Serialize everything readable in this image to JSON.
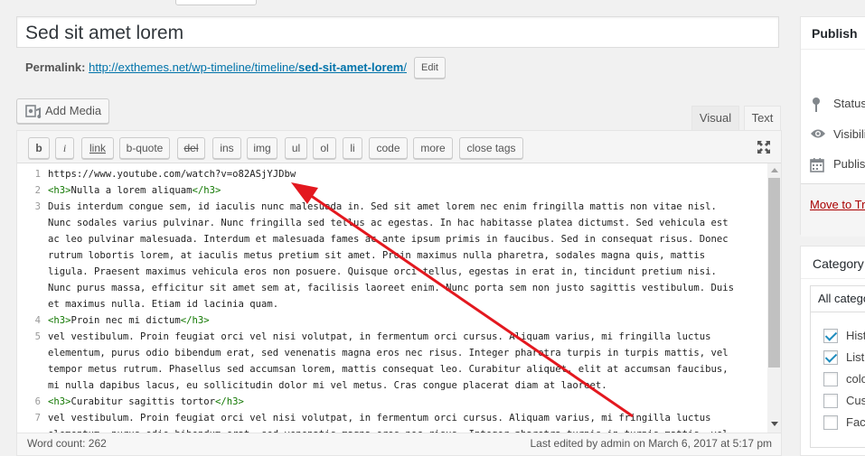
{
  "post": {
    "title": "Sed sit amet lorem",
    "permalink_label": "Permalink:",
    "permalink_base": "http://exthemes.net/wp-timeline/timeline/",
    "permalink_slug": "sed-sit-amet-lorem",
    "permalink_end": "/",
    "edit_label": "Edit"
  },
  "media": {
    "add_media_label": "Add Media"
  },
  "editor_tabs": {
    "visual": "Visual",
    "text": "Text"
  },
  "quicktags": [
    "b",
    "i",
    "link",
    "b-quote",
    "del",
    "ins",
    "img",
    "ul",
    "ol",
    "li",
    "code",
    "more",
    "close tags"
  ],
  "code_lines": [
    {
      "num": "1",
      "text": "https://www.youtube.com/watch?v=o82ASjYJDbw"
    },
    {
      "num": "2",
      "open": "<h3>",
      "text": "Nulla a lorem aliquam",
      "close": "</h3>"
    },
    {
      "num": "3",
      "text": "Duis interdum congue sem, id iaculis nunc malesuada in. Sed sit amet lorem nec enim fringilla mattis non vitae nisl."
    },
    {
      "num": "",
      "text": "Nunc sodales varius pulvinar. Nunc fringilla sed tellus ac egestas. In hac habitasse platea dictumst. Sed vehicula est"
    },
    {
      "num": "",
      "text": "ac leo pulvinar malesuada. Interdum et malesuada fames ac ante ipsum primis in faucibus. Sed in consequat risus. Donec"
    },
    {
      "num": "",
      "text": "rutrum lobortis lorem, at iaculis metus pretium sit amet. Proin maximus nulla pharetra, sodales magna quis, mattis"
    },
    {
      "num": "",
      "text": "ligula. Praesent maximus vehicula eros non posuere. Quisque orci tellus, egestas in erat in, tincidunt pretium nisi."
    },
    {
      "num": "",
      "text": "Nunc purus massa, efficitur sit amet sem at, facilisis laoreet enim. Nunc porta sem non justo sagittis vestibulum. Duis"
    },
    {
      "num": "",
      "text": "et maximus nulla. Etiam id lacinia quam."
    },
    {
      "num": "4",
      "open": "<h3>",
      "text": "Proin nec mi dictum",
      "close": "</h3>"
    },
    {
      "num": "5",
      "text": "vel vestibulum. Proin feugiat orci vel nisi volutpat, in fermentum orci cursus. Aliquam varius, mi fringilla luctus"
    },
    {
      "num": "",
      "text": "elementum, purus odio bibendum erat, sed venenatis magna eros nec risus. Integer pharetra turpis in turpis mattis, vel"
    },
    {
      "num": "",
      "text": "tempor metus rutrum. Phasellus sed accumsan lorem, mattis consequat leo. Curabitur aliquet, elit at accumsan faucibus,"
    },
    {
      "num": "",
      "text": "mi nulla dapibus lacus, eu sollicitudin dolor mi vel metus. Cras congue placerat diam at laoreet."
    },
    {
      "num": "6",
      "open": "<h3>",
      "text": "Curabitur sagittis tortor",
      "close": "</h3>"
    },
    {
      "num": "7",
      "text": "vel vestibulum. Proin feugiat orci vel nisi volutpat, in fermentum orci cursus. Aliquam varius, mi fringilla luctus"
    },
    {
      "num": "",
      "text": "elementum, purus odio bibendum erat, sed venenatis magna eros nec risus. Integer pharetra turpis in turpis mattis, vel"
    }
  ],
  "status": {
    "word_count": "Word count: 262",
    "last_edited": "Last edited by admin on March 6, 2017 at 5:17 pm"
  },
  "publish": {
    "title": "Publish",
    "status": "Status",
    "visibility": "Visibili",
    "published": "Publish",
    "trash": "Move to Tr"
  },
  "category": {
    "title": "Category",
    "tab_all": "All catego",
    "items": [
      {
        "label": "Hist",
        "checked": true
      },
      {
        "label": "List",
        "checked": true
      },
      {
        "label": "colo",
        "checked": false
      },
      {
        "label": "Cust",
        "checked": false
      },
      {
        "label": "Face",
        "checked": false
      }
    ]
  },
  "colors": {
    "link": "#0073aa",
    "trash": "#a00",
    "annotation_arrow": "#e3181f",
    "tag_green": "#117700"
  }
}
